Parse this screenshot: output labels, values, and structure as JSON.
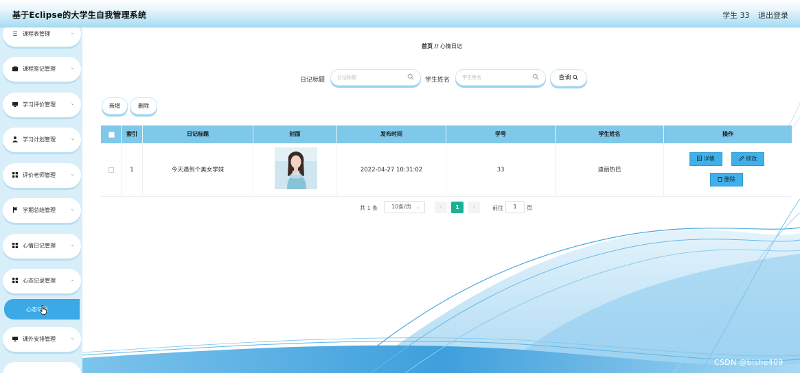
{
  "header": {
    "title": "基于Eclipse的大学生自我管理系统",
    "user": "学生 33",
    "logout": "退出登录"
  },
  "sidebar": {
    "items": [
      {
        "label": "课程表管理",
        "icon": "list-icon"
      },
      {
        "label": "课程笔记管理",
        "icon": "briefcase-icon"
      },
      {
        "label": "学习评价管理",
        "icon": "monitor-icon"
      },
      {
        "label": "学习计划管理",
        "icon": "user-icon"
      },
      {
        "label": "评价老师管理",
        "icon": "grid-icon"
      },
      {
        "label": "学期总结管理",
        "icon": "flag-icon"
      },
      {
        "label": "心情日记管理",
        "icon": "grid-icon"
      },
      {
        "label": "心态记录管理",
        "icon": "grid-icon"
      },
      {
        "label": "课外安排管理",
        "icon": "monitor-icon"
      }
    ],
    "active_sub": "心态记录"
  },
  "breadcrumb": {
    "home": "首页",
    "sep": "//",
    "current": "心情日记"
  },
  "search": {
    "title_label": "日记标题",
    "title_placeholder": "日记标题",
    "name_label": "学生姓名",
    "name_placeholder": "学生姓名",
    "query_label": "查询"
  },
  "actions": {
    "add": "新增",
    "delete": "删除"
  },
  "table": {
    "headers": [
      "索引",
      "日记标题",
      "封面",
      "发布时间",
      "学号",
      "学生姓名",
      "操作"
    ],
    "rows": [
      {
        "index": "1",
        "title": "今天遇到个美女学妹",
        "cover": "portrait-photo",
        "time": "2022-04-27 10:31:02",
        "student_id": "33",
        "student_name": "迪丽热巴"
      }
    ],
    "ops": {
      "detail": "详情",
      "edit": "修改",
      "delete": "删除"
    }
  },
  "pagination": {
    "total": "共 1 条",
    "page_size": "10条/页",
    "current": "1",
    "goto_label": "前往",
    "goto_value": "1",
    "page_unit": "页"
  },
  "watermark": "CSDN @bishe409",
  "colors": {
    "accent": "#41b0e8",
    "header_row": "#7ec8ea",
    "page_active": "#19b394",
    "sidebar_bg": "#d8eef8"
  }
}
